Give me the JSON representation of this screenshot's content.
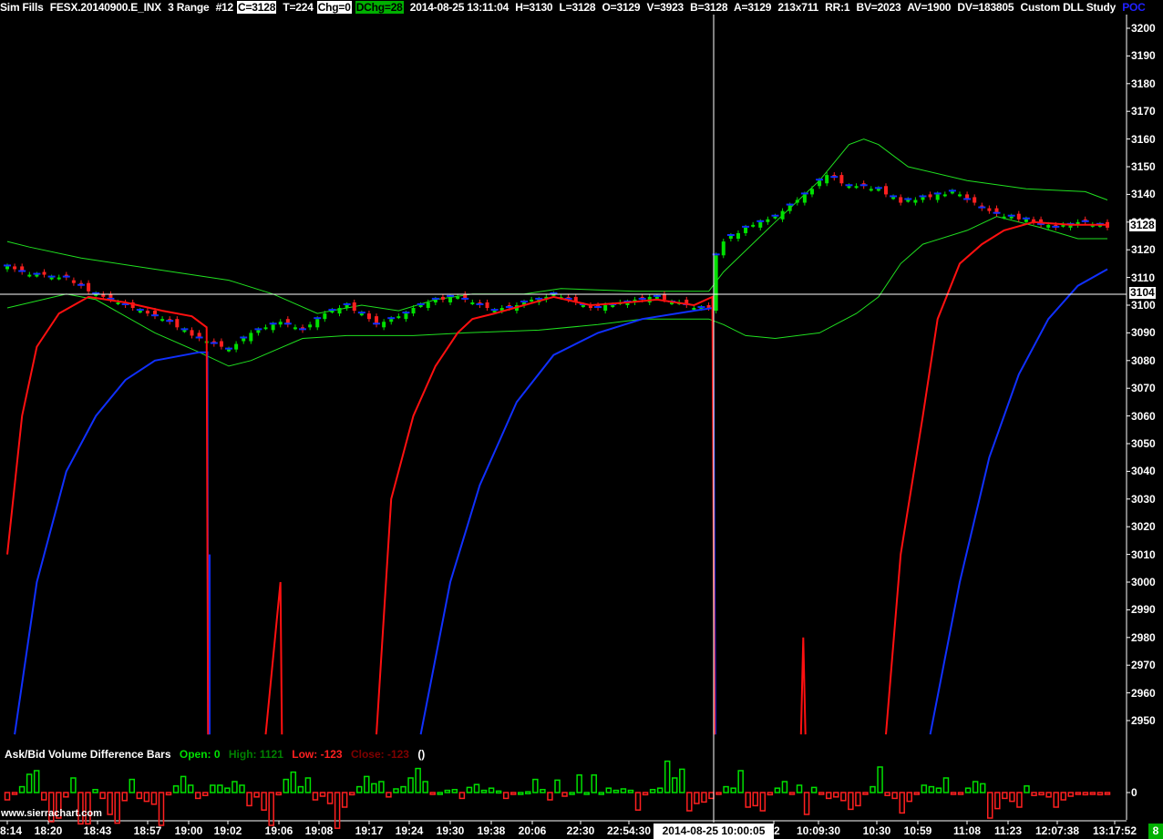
{
  "header": {
    "title": "Sim Fills",
    "symbol": "FESX.20140900.E_INX",
    "bar_type": "3 Range",
    "chart_number": "#12",
    "close": "C=3128",
    "ticks": "T=224",
    "change": "Chg=0",
    "daily_change": "DChg=28",
    "datetime": "2014-08-25 13:11:04",
    "high": "H=3130",
    "low": "L=3128",
    "open": "O=3129",
    "volume": "V=3923",
    "bid": "B=3128",
    "ask": "A=3129",
    "size": "213x711",
    "rr": "RR:1",
    "bid_volume": "BV=2023",
    "ask_volume": "AV=1900",
    "delta_volume": "DV=183805",
    "study": "Custom DLL Study",
    "poc": "POC"
  },
  "colors": {
    "up": "#00e000",
    "down": "#ff2020",
    "red_line": "#ff1010",
    "blue_line": "#1030ff",
    "band": "#20e020",
    "crosshair": "#ffffff"
  },
  "y_axis": {
    "labels": [
      "3200",
      "3190",
      "3180",
      "3170",
      "3160",
      "3150",
      "3140",
      "3130",
      "3120",
      "3110",
      "3100",
      "3090",
      "3080",
      "3070",
      "3060",
      "3050",
      "3040",
      "3030",
      "3020",
      "3010",
      "3000",
      "2990",
      "2980",
      "2970",
      "2960",
      "2950"
    ],
    "last_price": "3128",
    "crosshair_price": "3104",
    "sub_zero": "0"
  },
  "x_axis": {
    "labels": [
      "8:14",
      "18:20",
      "18:43",
      "18:57",
      "19:00",
      "19:02",
      "19:06",
      "19:08",
      "19:17",
      "19:24",
      "19:30",
      "19:38",
      "20:06",
      "22:30",
      "22:54:30",
      "02",
      "10:09:30",
      "10:30",
      "10:59",
      "11:08",
      "11:23",
      "12:07:38",
      "13:17:52"
    ],
    "crosshair_time": "2014-08-25  10:00:05",
    "badge": "8"
  },
  "subgraph": {
    "title": "Ask/Bid Volume Difference Bars",
    "open": "Open: 0",
    "high": "High: 1121",
    "low": "Low: -123",
    "close": "Close: -123",
    "extra": "()"
  },
  "watermark": "www.sierrachart.com",
  "chart_data": {
    "type": "candlestick",
    "bar_count": 150,
    "ylim": [
      2945,
      3205
    ],
    "crosshair": {
      "bar": 95.7,
      "price": 3104
    },
    "close_keypoints": [
      [
        0,
        3114
      ],
      [
        3,
        3111
      ],
      [
        8,
        3110
      ],
      [
        11,
        3105
      ],
      [
        16,
        3100
      ],
      [
        21,
        3095
      ],
      [
        26,
        3088
      ],
      [
        30,
        3084
      ],
      [
        33,
        3090
      ],
      [
        37,
        3094
      ],
      [
        40,
        3091
      ],
      [
        43,
        3097
      ],
      [
        46,
        3100
      ],
      [
        50,
        3093
      ],
      [
        53,
        3096
      ],
      [
        57,
        3101
      ],
      [
        61,
        3103
      ],
      [
        66,
        3098
      ],
      [
        69,
        3100
      ],
      [
        74,
        3104
      ],
      [
        79,
        3099
      ],
      [
        84,
        3101
      ],
      [
        88,
        3103
      ],
      [
        93,
        3099
      ],
      [
        95,
        3099
      ],
      [
        96,
        3118
      ],
      [
        97,
        3123
      ],
      [
        100,
        3128
      ],
      [
        104,
        3132
      ],
      [
        108,
        3140
      ],
      [
        111,
        3147
      ],
      [
        114,
        3143
      ],
      [
        118,
        3142
      ],
      [
        121,
        3137
      ],
      [
        125,
        3139
      ],
      [
        128,
        3141
      ],
      [
        132,
        3135
      ],
      [
        135,
        3132
      ],
      [
        139,
        3130
      ],
      [
        142,
        3128
      ],
      [
        146,
        3130
      ],
      [
        149,
        3128
      ]
    ],
    "red_line": [
      [
        [
          0,
          3010
        ],
        [
          2,
          3060
        ],
        [
          4,
          3085
        ],
        [
          7,
          3097
        ],
        [
          11,
          3103
        ],
        [
          16,
          3101
        ],
        [
          21,
          3098
        ],
        [
          25,
          3096
        ],
        [
          27,
          3092
        ],
        [
          27.2,
          2945
        ]
      ],
      [
        [
          35,
          2945
        ],
        [
          37,
          3000
        ],
        [
          37.2,
          2945
        ]
      ],
      [
        [
          50,
          2945
        ],
        [
          52,
          3030
        ],
        [
          55,
          3060
        ],
        [
          58,
          3078
        ],
        [
          61,
          3090
        ],
        [
          63,
          3095
        ],
        [
          66,
          3097
        ],
        [
          70,
          3100
        ],
        [
          74,
          3103
        ],
        [
          79,
          3100
        ],
        [
          84,
          3101
        ],
        [
          88,
          3102
        ],
        [
          93,
          3100
        ],
        [
          95.5,
          3103
        ],
        [
          95.8,
          2945
        ]
      ],
      [
        [
          107.5,
          2945
        ],
        [
          107.8,
          2980
        ],
        [
          108.1,
          2945
        ]
      ],
      [
        [
          119,
          2945
        ],
        [
          121,
          3010
        ],
        [
          124,
          3060
        ],
        [
          126,
          3095
        ],
        [
          129,
          3115
        ],
        [
          132,
          3122
        ],
        [
          135,
          3127
        ],
        [
          139,
          3130
        ],
        [
          144,
          3129
        ],
        [
          149,
          3129
        ]
      ]
    ],
    "blue_line": [
      [
        [
          1,
          2945
        ],
        [
          4,
          3000
        ],
        [
          8,
          3040
        ],
        [
          12,
          3060
        ],
        [
          16,
          3073
        ],
        [
          20,
          3080
        ],
        [
          26,
          3083
        ],
        [
          27.1,
          3083
        ],
        [
          27.2,
          2945
        ]
      ],
      [
        [
          27.4,
          2945
        ],
        [
          27.4,
          3010
        ]
      ],
      [
        [
          56,
          2945
        ],
        [
          60,
          3000
        ],
        [
          64,
          3035
        ],
        [
          69,
          3065
        ],
        [
          74,
          3082
        ],
        [
          80,
          3090
        ],
        [
          86,
          3095
        ],
        [
          93,
          3098
        ],
        [
          95.6,
          3099
        ],
        [
          95.9,
          2945
        ]
      ],
      [
        [
          125,
          2945
        ],
        [
          129,
          3000
        ],
        [
          133,
          3045
        ],
        [
          137,
          3075
        ],
        [
          141,
          3095
        ],
        [
          145,
          3107
        ],
        [
          149,
          3113
        ]
      ]
    ],
    "upper_band": [
      [
        0,
        3123
      ],
      [
        3,
        3121
      ],
      [
        10,
        3117
      ],
      [
        20,
        3113
      ],
      [
        30,
        3109
      ],
      [
        36,
        3104
      ],
      [
        42,
        3097
      ],
      [
        48,
        3100
      ],
      [
        53,
        3098
      ],
      [
        58,
        3102
      ],
      [
        63,
        3104
      ],
      [
        70,
        3104
      ],
      [
        75,
        3106
      ],
      [
        85,
        3105
      ],
      [
        95,
        3105
      ],
      [
        97,
        3112
      ],
      [
        104,
        3130
      ],
      [
        110,
        3145
      ],
      [
        114,
        3158
      ],
      [
        116,
        3160
      ],
      [
        118,
        3158
      ],
      [
        122,
        3150
      ],
      [
        130,
        3145
      ],
      [
        138,
        3142
      ],
      [
        146,
        3141
      ],
      [
        149,
        3138
      ]
    ],
    "lower_band": [
      [
        0,
        3099
      ],
      [
        8,
        3104
      ],
      [
        12,
        3102
      ],
      [
        20,
        3090
      ],
      [
        26,
        3083
      ],
      [
        30,
        3078
      ],
      [
        33,
        3080
      ],
      [
        40,
        3088
      ],
      [
        46,
        3089
      ],
      [
        55,
        3089
      ],
      [
        62,
        3090
      ],
      [
        72,
        3091
      ],
      [
        80,
        3093
      ],
      [
        86,
        3095
      ],
      [
        95,
        3095
      ],
      [
        97,
        3093
      ],
      [
        100,
        3089
      ],
      [
        104,
        3088
      ],
      [
        110,
        3090
      ],
      [
        115,
        3097
      ],
      [
        118,
        3103
      ],
      [
        121,
        3115
      ],
      [
        124,
        3122
      ],
      [
        130,
        3127
      ],
      [
        134,
        3132
      ],
      [
        140,
        3128
      ],
      [
        145,
        3124
      ],
      [
        149,
        3124
      ]
    ],
    "volume_diff": [
      -100,
      -20,
      80,
      250,
      300,
      -100,
      -400,
      -350,
      -60,
      200,
      -430,
      -430,
      40,
      -80,
      -300,
      -420,
      -110,
      180,
      -80,
      -120,
      -160,
      -450,
      -30,
      90,
      220,
      100,
      -80,
      -40,
      100,
      100,
      60,
      150,
      100,
      -180,
      -60,
      -240,
      -450,
      -30,
      180,
      280,
      80,
      200,
      -100,
      -50,
      -150,
      -490,
      -200,
      -30,
      80,
      220,
      120,
      150,
      -60,
      50,
      80,
      200,
      330,
      150,
      -10,
      0,
      30,
      40,
      -80,
      70,
      110,
      30,
      60,
      20,
      -80,
      -20,
      0,
      10,
      180,
      40,
      -100,
      170,
      -50,
      0,
      240,
      0,
      240,
      0,
      60,
      30,
      50,
      30,
      -240,
      -30,
      40,
      60,
      430,
      200,
      320,
      -250,
      -150,
      -130,
      -80,
      -20,
      80,
      60,
      300,
      -200,
      -180,
      -250,
      -30,
      60,
      150,
      -5,
      100,
      -300,
      70,
      -10,
      -80,
      -60,
      -110,
      -230,
      -180,
      -20,
      80,
      350,
      -40,
      -80,
      -280,
      -120,
      -20,
      100,
      80,
      60,
      200,
      -10,
      -5,
      60,
      150,
      120,
      -350,
      -220,
      -80,
      -120,
      -200,
      90,
      -40,
      -30,
      -60,
      -200,
      -100,
      -50,
      -20,
      -30,
      -10,
      -30,
      -20
    ],
    "volume_diff_range": [
      -500,
      1121
    ]
  }
}
